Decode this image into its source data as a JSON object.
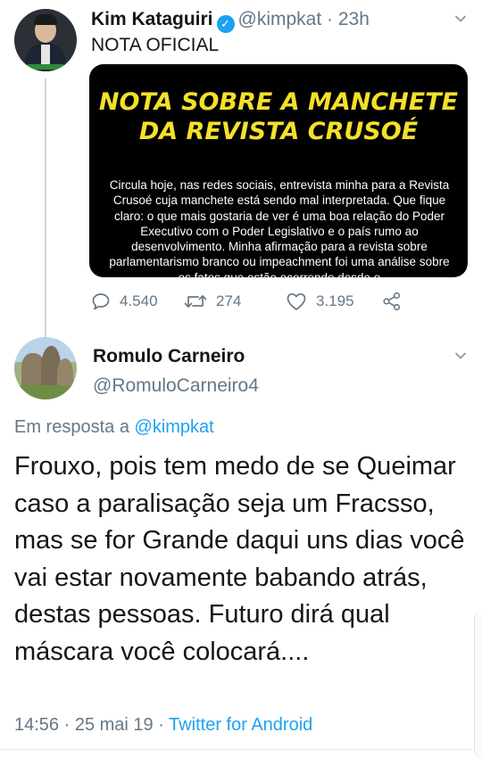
{
  "tweet": {
    "author_name": "Kim Kataguiri",
    "author_handle": "@kimpkat",
    "time": "23h",
    "text": "NOTA OFICIAL",
    "media": {
      "title_line1": "NOTA SOBRE A MANCHETE",
      "title_line2": "DA REVISTA CRUSOÉ",
      "body": "Circula hoje, nas redes sociais, entrevista minha para a Revista Crusoé cuja manchete está sendo mal interpretada. Que fique claro: o que mais gostaria de ver é uma boa relação do Poder Executivo com o Poder Legislativo e o país rumo ao desenvolvimento. Minha afirmação para a revista sobre parlamentarismo branco ou impeachment foi uma análise sobre os fatos que estão ocorrendo desde o"
    },
    "stats": {
      "replies": "4.540",
      "retweets": "274",
      "likes": "3.195"
    }
  },
  "reply": {
    "author_name": "Romulo Carneiro",
    "author_handle": "@RomuloCarneiro4",
    "in_reply_prefix": "Em resposta a",
    "in_reply_handle": "@kimpkat",
    "text": "Frouxo, pois tem medo de se Queimar caso a paralisação seja um Fracsso, mas se for Grande daqui uns dias você vai estar novamente babando atrás, destas pessoas. Futuro dirá qual máscara você colocará....",
    "timestamp": "14:56 · 25 mai 19 ·",
    "source": "Twitter for Android"
  },
  "colors": {
    "link": "#1da1f2",
    "secondary_text": "#657786",
    "primary_text": "#14171a",
    "media_title": "#f4e02a"
  },
  "icons": {
    "reply": "reply-icon",
    "retweet": "retweet-icon",
    "like": "heart-icon",
    "share": "share-icon",
    "verified": "verified-badge-icon",
    "menu": "chevron-down-icon"
  }
}
